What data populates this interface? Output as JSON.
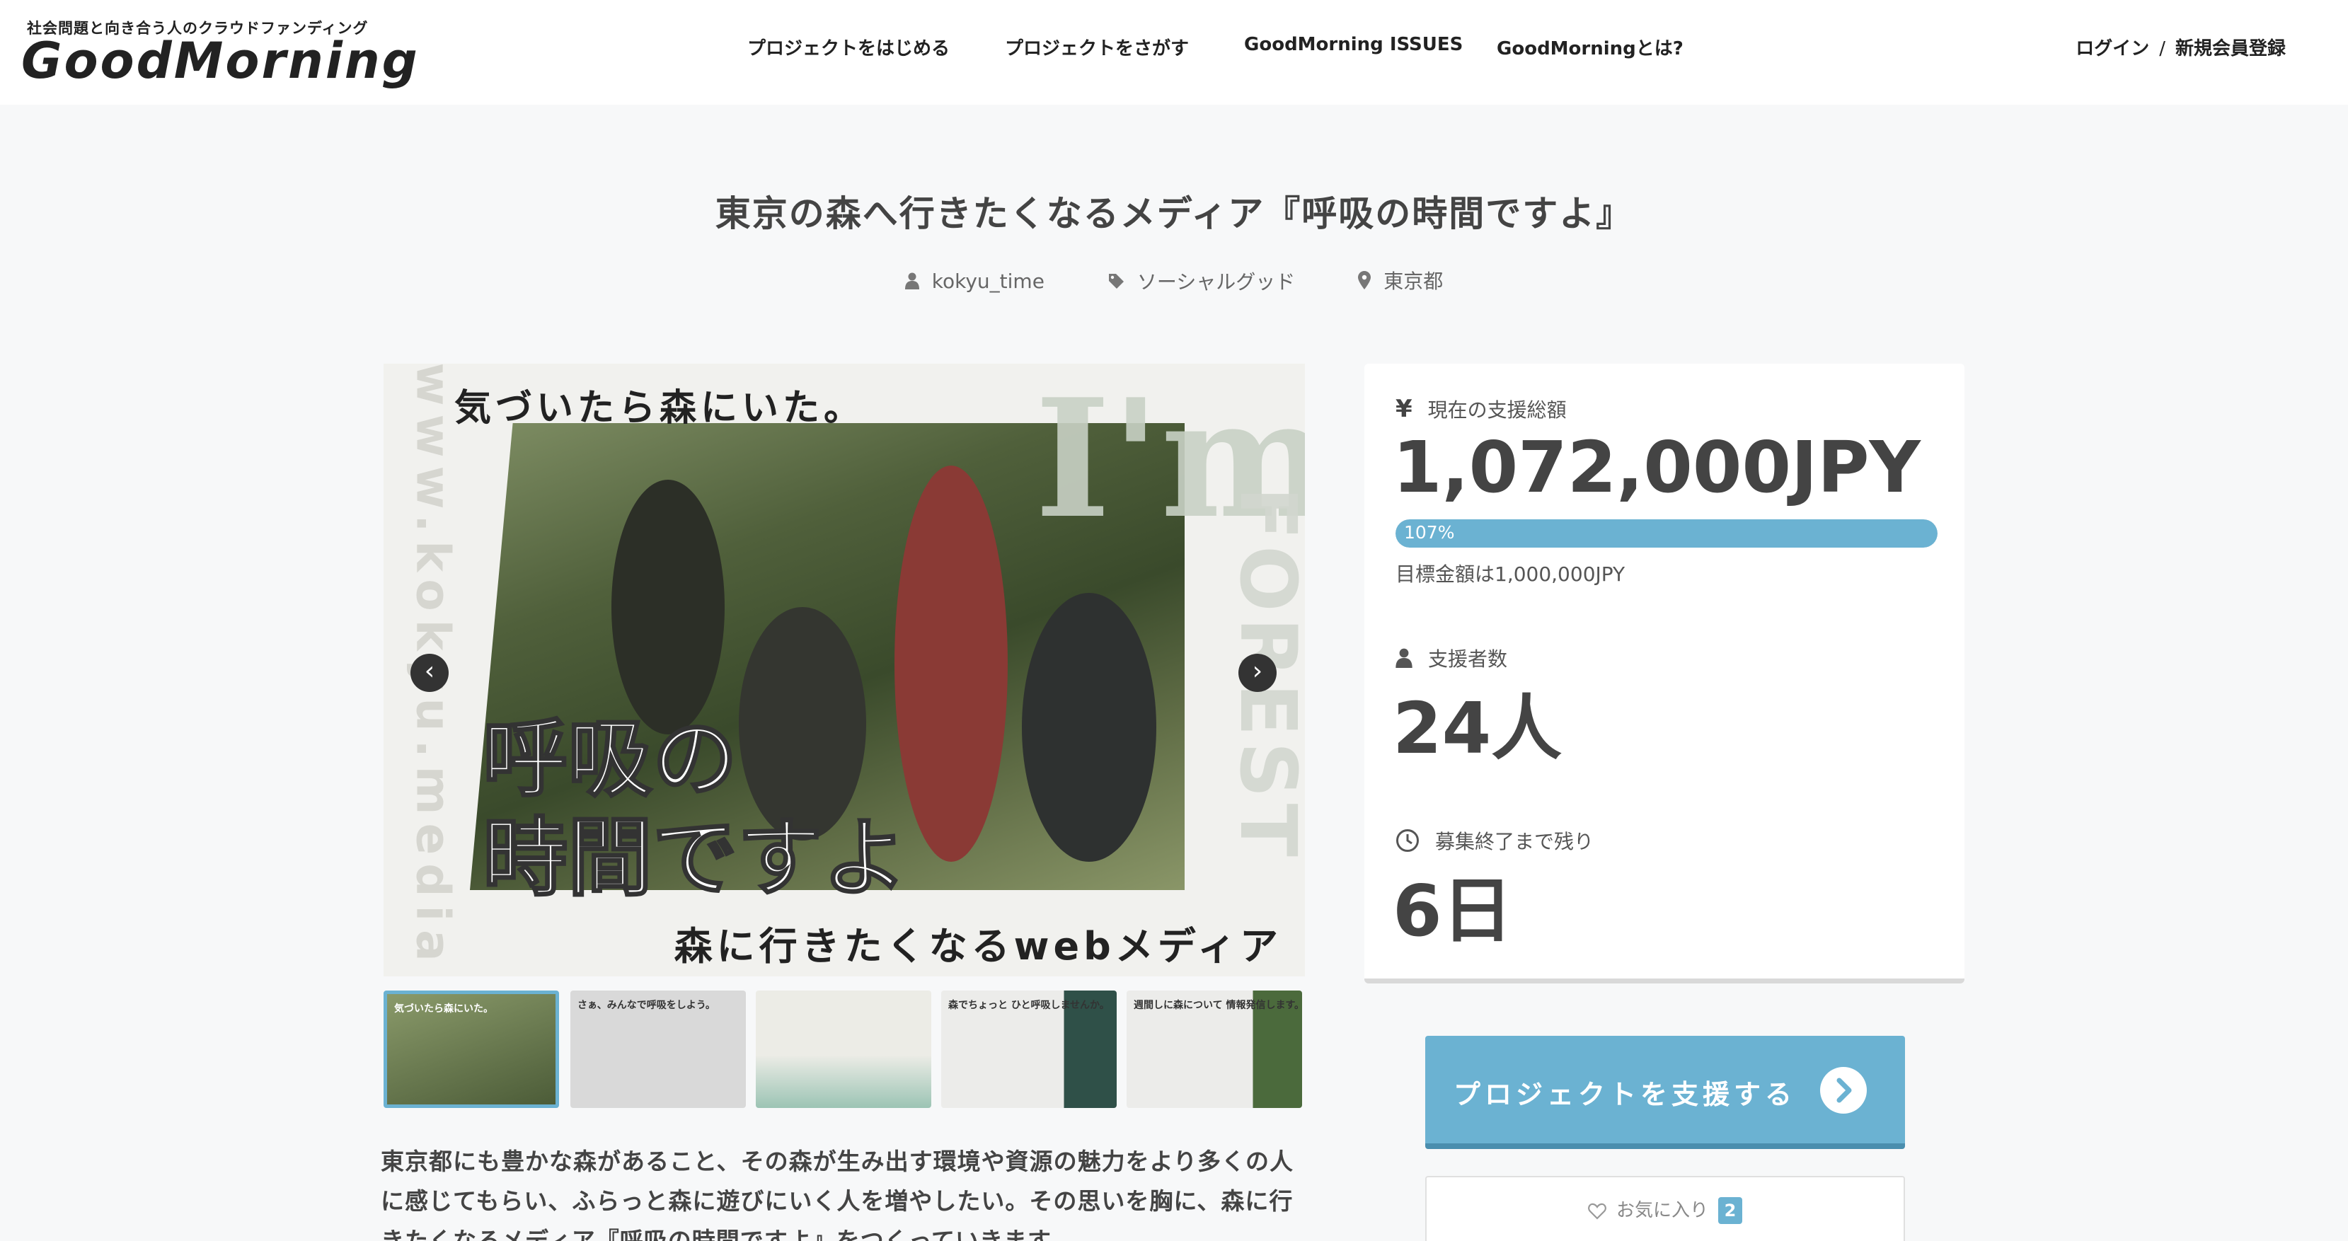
{
  "header": {
    "tagline": "社会問題と向き合う人のクラウドファンディング",
    "logo": "GoodMorning",
    "nav": [
      {
        "label": "プロジェクトをはじめる"
      },
      {
        "label": "プロジェクトをさがす"
      },
      {
        "label": "GoodMorning ISSUES"
      },
      {
        "label": "GoodMorningとは?"
      }
    ],
    "login": "ログイン",
    "auth_separator": "/",
    "register": "新規会員登録"
  },
  "project": {
    "title": "東京の森へ行きたくなるメディア『呼吸の時間ですよ』",
    "owner": "kokyu_time",
    "category": "ソーシャルグッド",
    "location": "東京都"
  },
  "gallery": {
    "main": {
      "headline": "気づいたら森にいた。",
      "url_text": "www.kokyu.media",
      "badge_top": "I'm",
      "badge_side": "FOREST",
      "copy_line1": "呼吸の",
      "copy_line2": "時間ですよ",
      "subline": "森に行きたくなるwebメディア"
    },
    "prev_label": "‹",
    "next_label": "›",
    "thumbs": [
      {
        "caption": "気づいたら森にいた。"
      },
      {
        "caption": "さぁ、みんなで呼吸をしよう。"
      },
      {
        "caption": ""
      },
      {
        "caption": "森でちょっと ひと呼吸しませんか。"
      },
      {
        "caption": "週間しに森について 情報発信します。"
      }
    ]
  },
  "stats": {
    "amount_label": "現在の支援総額",
    "amount_value": "1,072,000JPY",
    "progress_text": "107%",
    "progress_percent": 107,
    "goal_text": "目標金額は1,000,000JPY",
    "supporters_label": "支援者数",
    "supporters_value": "24人",
    "remaining_label": "募集終了まで残り",
    "remaining_value": "6日"
  },
  "actions": {
    "support_label": "プロジェクトを支援する",
    "favorite_label": "お気に入り",
    "favorite_count": "2"
  },
  "description": "東京都にも豊かな森があること、その森が生み出す環境や資源の魅力をより多くの人に感じてもらい、ふらっと森に遊びにいく人を増やしたい。その思いを胸に、森に行きたくなるメディア『呼吸の時間ですよ』をつくっていきます。",
  "colors": {
    "accent": "#6bb2d2",
    "background": "#f7f8f9",
    "text": "#444444"
  }
}
